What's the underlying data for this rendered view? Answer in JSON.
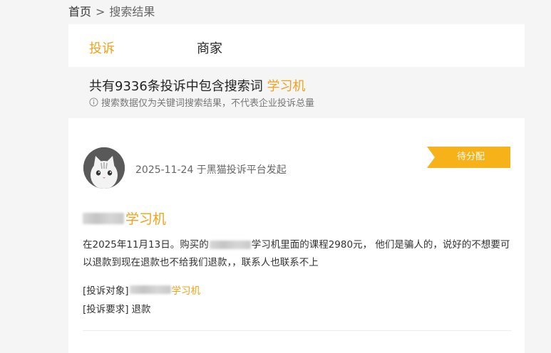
{
  "breadcrumb": {
    "home": "首页",
    "separator": ">",
    "current": "搜索结果"
  },
  "tabs": {
    "complaints": "投诉",
    "merchants": "商家"
  },
  "summary": {
    "prefix": "共有9336条投诉中包含搜索词",
    "keyword": "学习机"
  },
  "note": {
    "text": "搜索数据仅为关键词搜索结果，不代表企业投诉总量",
    "icon": "info-icon"
  },
  "complaint": {
    "date_source": "2025-11-24 于黑猫投诉平台发起",
    "status": "待分配",
    "title_suffix": "学习机",
    "description_part1": "在2025年11月13日。购买的",
    "description_part2": "学习机里面的课程2980元， 他们是骗人的，说好的不想要可以退款到现在退款也不给我们退款，，联系人也联系不上",
    "target_label": "[投诉对象]",
    "target_value": "学习机",
    "request_label": "[投诉要求]",
    "request_value": "退款"
  },
  "colors": {
    "accent": "#f0a21c",
    "status_bg": "#f8b219"
  }
}
